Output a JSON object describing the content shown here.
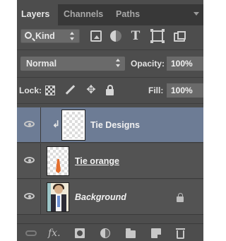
{
  "tabs": [
    {
      "label": "Layers",
      "active": true
    },
    {
      "label": "Channels",
      "active": false
    },
    {
      "label": "Paths",
      "active": false
    }
  ],
  "filter": {
    "kind_label": "Kind",
    "icons": [
      "image-filter-icon",
      "adjustment-filter-icon",
      "type-filter-icon",
      "shape-filter-icon",
      "smart-object-filter-icon"
    ]
  },
  "blend": {
    "mode": "Normal",
    "opacity_label": "Opacity:",
    "opacity_value": "100%"
  },
  "lock": {
    "label": "Lock:",
    "fill_label": "Fill:",
    "fill_value": "100%"
  },
  "layers": [
    {
      "name": "Tie Designs",
      "selected": true,
      "clipping": true,
      "visible": true
    },
    {
      "name": "Tie orange",
      "selected": false,
      "clipping": false,
      "visible": true
    },
    {
      "name": "Background",
      "selected": false,
      "clipping": false,
      "visible": true,
      "locked": true
    }
  ],
  "footer_icons": [
    "link-layers-icon",
    "fx-icon",
    "add-mask-icon",
    "new-adjustment-icon",
    "new-group-icon",
    "new-layer-icon",
    "trash-icon"
  ],
  "colors": {
    "panel_bg": "#4d4d4d",
    "selected_layer": "#6d7c95",
    "tab_bar": "#383838"
  }
}
